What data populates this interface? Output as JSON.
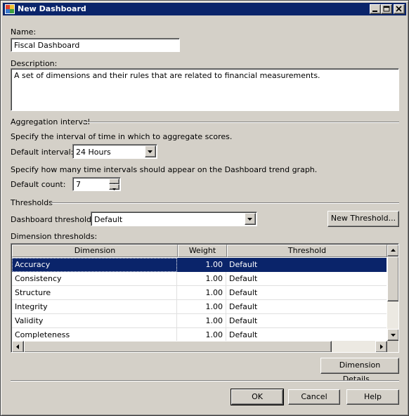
{
  "window": {
    "title": "New Dashboard"
  },
  "form": {
    "name_label": "Name:",
    "name_value": "Fiscal Dashboard",
    "description_label": "Description:",
    "description_value": "A set of dimensions and their rules that are related to financial measurements."
  },
  "aggregation": {
    "group_label": "Aggregation interval",
    "interval_hint": "Specify the interval of time in which to aggregate scores.",
    "interval_label": "Default interval:",
    "interval_value": "24 Hours",
    "count_hint": "Specify how many time intervals should appear on the Dashboard trend graph.",
    "count_label": "Default count:",
    "count_value": "7"
  },
  "thresholds": {
    "group_label": "Thresholds",
    "dashboard_threshold_label": "Dashboard threshold:",
    "dashboard_threshold_value": "Default",
    "new_threshold_button": "New Threshold...",
    "dimension_thresholds_label": "Dimension thresholds:"
  },
  "grid": {
    "columns": [
      "Dimension",
      "Weight",
      "Threshold"
    ],
    "rows": [
      {
        "dimension": "Accuracy",
        "weight": "1.00",
        "threshold": "Default",
        "selected": true
      },
      {
        "dimension": "Consistency",
        "weight": "1.00",
        "threshold": "Default"
      },
      {
        "dimension": "Structure",
        "weight": "1.00",
        "threshold": "Default"
      },
      {
        "dimension": "Integrity",
        "weight": "1.00",
        "threshold": "Default"
      },
      {
        "dimension": "Validity",
        "weight": "1.00",
        "threshold": "Default"
      },
      {
        "dimension": "Completeness",
        "weight": "1.00",
        "threshold": "Default"
      }
    ]
  },
  "buttons": {
    "dimension_details": "Dimension Details...",
    "ok": "OK",
    "cancel": "Cancel",
    "help": "Help"
  },
  "colors": {
    "titlebar": "#0a246a",
    "selection": "#0a246a",
    "face": "#d4d0c8"
  }
}
